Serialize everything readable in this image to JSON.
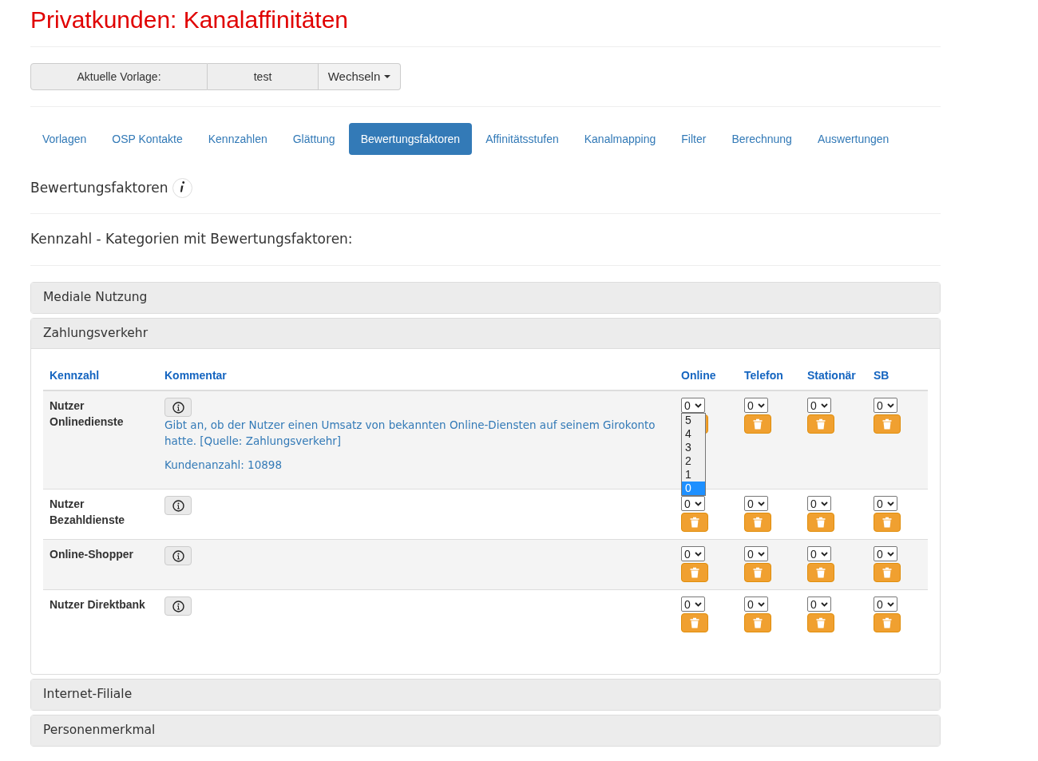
{
  "title": "Privatkunden: Kanalaffinitäten",
  "template": {
    "label": "Aktuelle Vorlage:",
    "value": "test",
    "button": "Wechseln"
  },
  "tabs": [
    {
      "label": "Vorlagen",
      "selected": false
    },
    {
      "label": "OSP Kontakte",
      "selected": false
    },
    {
      "label": "Kennzahlen",
      "selected": false
    },
    {
      "label": "Glättung",
      "selected": false
    },
    {
      "label": "Bewertungsfaktoren",
      "selected": true
    },
    {
      "label": "Affinitätsstufen",
      "selected": false
    },
    {
      "label": "Kanalmapping",
      "selected": false
    },
    {
      "label": "Filter",
      "selected": false
    },
    {
      "label": "Berechnung",
      "selected": false
    },
    {
      "label": "Auswertungen",
      "selected": false
    }
  ],
  "section_heading": "Bewertungsfaktoren",
  "subheading": "Kennzahl - Kategorien mit Bewertungsfaktoren:",
  "panels": [
    {
      "title": "Mediale Nutzung",
      "expanded": false
    },
    {
      "title": "Zahlungsverkehr",
      "expanded": true,
      "table": {
        "columns": [
          "Kennzahl",
          "Kommentar",
          "Online",
          "Telefon",
          "Stationär",
          "SB"
        ],
        "rows": [
          {
            "name": "Nutzer Onlinedienste",
            "comment": "Gibt an, ob der Nutzer einen Umsatz von bekannten Online-Diensten auf seinem Girokonto hatte. [Quelle: Zahlungsverkehr]",
            "count": "Kundenanzahl: 10898",
            "values": [
              "0",
              "0",
              "0",
              "0"
            ],
            "open_dropdown": {
              "options": [
                {
                  "label": "5",
                  "selected": false
                },
                {
                  "label": "4",
                  "selected": false
                },
                {
                  "label": "3",
                  "selected": false
                },
                {
                  "label": "2",
                  "selected": false
                },
                {
                  "label": "1",
                  "selected": false
                },
                {
                  "label": "0",
                  "selected": true
                }
              ]
            }
          },
          {
            "name": "Nutzer Bezahldienste",
            "values": [
              "0",
              "0",
              "0",
              "0"
            ]
          },
          {
            "name": "Online-Shopper",
            "values": [
              "0",
              "0",
              "0",
              "0"
            ]
          },
          {
            "name": "Nutzer Direktbank",
            "values": [
              "0",
              "0",
              "0",
              "0"
            ]
          }
        ]
      }
    },
    {
      "title": "Internet-Filiale",
      "expanded": false
    },
    {
      "title": "Personenmerkmal",
      "expanded": false
    }
  ]
}
